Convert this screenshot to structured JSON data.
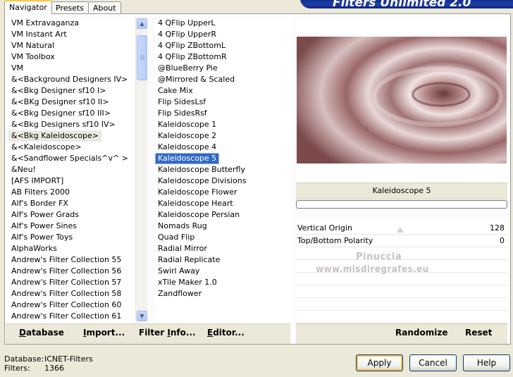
{
  "window": {
    "banner_title": "Filters Unlimited 2.0"
  },
  "tabs": [
    {
      "label": "Navigator",
      "active": true
    },
    {
      "label": "Presets",
      "active": false
    },
    {
      "label": "About",
      "active": false
    }
  ],
  "categories": [
    "VM Extravaganza",
    "VM Instant Art",
    "VM Natural",
    "VM Toolbox",
    "VM",
    "&<Background Designers IV>",
    "&<Bkg Designer sf10 I>",
    "&<BKg Designer sf10 II>",
    "&<Bkg Designer sf10 III>",
    "&<Bkg Designers sf10 IV>",
    "&<Bkg Kaleidoscope>",
    "&<Kaleidoscope>",
    "&<Sandflower Specials^v^ >",
    "&Neu!",
    "[AFS IMPORT]",
    "AB Filters 2000",
    "Alf's Border FX",
    "Alf's Power Grads",
    "Alf's Power Sines",
    "Alf's Power Toys",
    "AlphaWorks",
    "Andrew's Filter Collection 55",
    "Andrew's Filter Collection 56",
    "Andrew's Filter Collection 57",
    "Andrew's Filter Collection 58",
    "Andrew's Filter Collection 60",
    "Andrew's Filter Collection 61"
  ],
  "categories_selected": "&<Bkg Kaleidoscope>",
  "filters": [
    "4 QFlip UpperL",
    "4 QFlip UpperR",
    "4 QFlip ZBottomL",
    "4 QFlip ZBottomR",
    "@BlueBerry Pie",
    "@Mirrored & Scaled",
    "Cake Mix",
    "Flip SidesLsf",
    "Flip SidesRsf",
    "Kaleidoscope 1",
    "Kaleidoscope 2",
    "Kaleidoscope 4",
    "Kaleidoscope 5",
    "Kaleidoscope Butterfly",
    "Kaleidoscope Divisions",
    "Kaleidoscope Flower",
    "Kaleidoscope Heart",
    "Kaleidoscope Persian",
    "Nomads Rug",
    "Quad Flip",
    "Radial Mirror",
    "Radial Replicate",
    "Swirl Away",
    "xTile Maker 1.0",
    "Zandflower"
  ],
  "filters_selected": "Kaleidoscope 5",
  "preview": {
    "filter_name": "Kaleidoscope 5",
    "progress": 0
  },
  "params": [
    {
      "label": "Vertical Origin",
      "value": "128",
      "slider_value": 128,
      "slider_max": 255
    },
    {
      "label": "Top/Bottom Polarity",
      "value": "0",
      "slider_value": 0,
      "slider_max": 255
    }
  ],
  "watermark": {
    "line1": "Pinuccia",
    "line2": "www.misdiregrafes.eu"
  },
  "toolbar": {
    "database_u": "D",
    "database_rest": "atabase",
    "import_u": "I",
    "import_rest": "mport...",
    "filterinfo_a": "Filter ",
    "filterinfo_u": "I",
    "filterinfo_rest": "nfo...",
    "editor_u": "E",
    "editor_rest": "ditor...",
    "randomize": "Randomize",
    "reset": "Reset"
  },
  "status": {
    "database_label": "Database:",
    "database_value": "ICNET-Filters",
    "filters_label": "Filters:",
    "filters_value": "1366"
  },
  "buttons": {
    "apply": "Apply",
    "cancel": "Cancel",
    "help": "Help"
  },
  "colors": {
    "selection": "#316ac5",
    "accent_tab": "#ffc83c",
    "banner": "#1e3fa8"
  }
}
